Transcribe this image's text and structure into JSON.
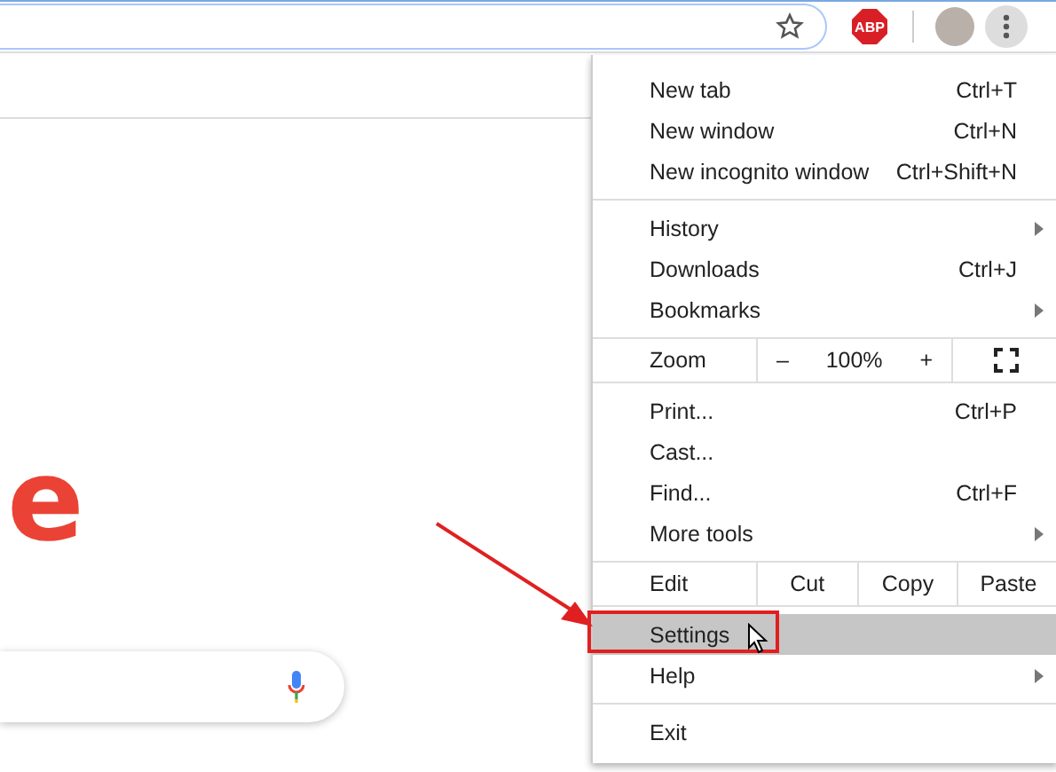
{
  "toolbar": {
    "adblock_badge": "ABP"
  },
  "page": {
    "logo_letter": "e"
  },
  "menu": {
    "sections": [
      {
        "items": [
          {
            "kind": "item",
            "label": "New tab",
            "shortcut": "Ctrl+T",
            "submenu": false,
            "selected": false,
            "callout": false
          },
          {
            "kind": "item",
            "label": "New window",
            "shortcut": "Ctrl+N",
            "submenu": false,
            "selected": false,
            "callout": false
          },
          {
            "kind": "item",
            "label": "New incognito window",
            "shortcut": "Ctrl+Shift+N",
            "submenu": false,
            "selected": false,
            "callout": false
          }
        ]
      },
      {
        "items": [
          {
            "kind": "item",
            "label": "History",
            "submenu": true,
            "selected": false,
            "callout": false
          },
          {
            "kind": "item",
            "label": "Downloads",
            "shortcut": "Ctrl+J",
            "submenu": false,
            "selected": false,
            "callout": false
          },
          {
            "kind": "item",
            "label": "Bookmarks",
            "submenu": true,
            "selected": false,
            "callout": false
          }
        ]
      },
      {
        "items": [
          {
            "kind": "zoom",
            "label": "Zoom",
            "minus": "–",
            "value": "100%",
            "plus": "+"
          }
        ]
      },
      {
        "items": [
          {
            "kind": "item",
            "label": "Print...",
            "shortcut": "Ctrl+P",
            "submenu": false,
            "selected": false,
            "callout": false
          },
          {
            "kind": "item",
            "label": "Cast...",
            "submenu": false,
            "selected": false,
            "callout": false
          },
          {
            "kind": "item",
            "label": "Find...",
            "shortcut": "Ctrl+F",
            "submenu": false,
            "selected": false,
            "callout": false
          },
          {
            "kind": "item",
            "label": "More tools",
            "submenu": true,
            "selected": false,
            "callout": false
          }
        ]
      },
      {
        "items": [
          {
            "kind": "edit",
            "label": "Edit",
            "actions": [
              "Cut",
              "Copy",
              "Paste"
            ]
          },
          {
            "kind": "item",
            "label": "Settings",
            "submenu": false,
            "selected": true,
            "callout": true
          },
          {
            "kind": "item",
            "label": "Help",
            "submenu": true,
            "selected": false,
            "callout": false
          }
        ]
      },
      {
        "items": [
          {
            "kind": "item",
            "label": "Exit",
            "submenu": false,
            "selected": false,
            "callout": false
          }
        ]
      }
    ]
  }
}
